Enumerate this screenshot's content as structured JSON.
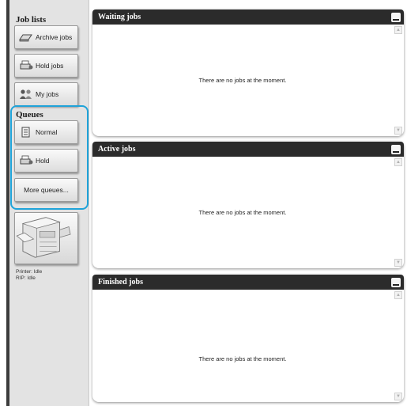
{
  "sidebar": {
    "job_lists_title": "Job lists",
    "archive_jobs": "Archive jobs",
    "hold_jobs": "Hold jobs",
    "my_jobs": "My jobs",
    "queues_title": "Queues",
    "normal": "Normal",
    "hold": "Hold",
    "more_queues": "More queues...",
    "printer_status": "Printer: Idle",
    "rip_status": "RIP: Idle"
  },
  "panels": {
    "waiting": {
      "title": "Waiting jobs",
      "empty": "There are no jobs at the moment."
    },
    "active": {
      "title": "Active jobs",
      "empty": "There are no jobs at the moment."
    },
    "finished": {
      "title": "Finished jobs",
      "empty": "There are no jobs at the moment."
    }
  },
  "colors": {
    "accent": "#1fa3d9",
    "header": "#2b2b2b",
    "sidebar": "#e3e3e3"
  }
}
